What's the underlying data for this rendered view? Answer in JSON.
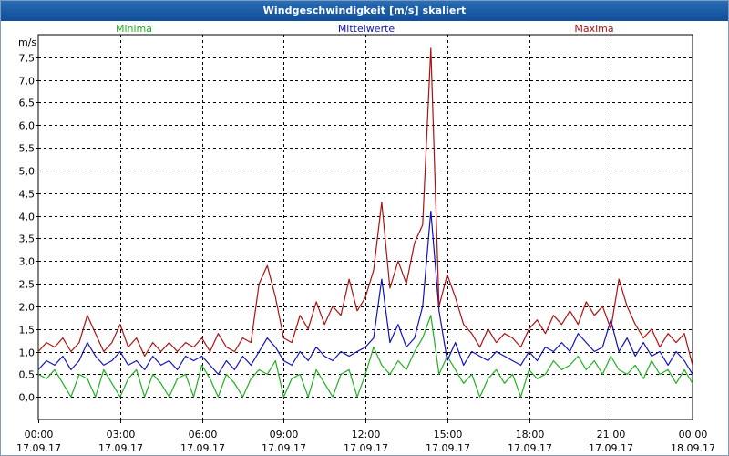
{
  "window": {
    "title": "Windgeschwindigkeit [m/s] skaliert"
  },
  "colors": {
    "min": "#20b020",
    "mean": "#1010c0",
    "max": "#b01010",
    "grid": "#000000"
  },
  "chart_data": {
    "type": "line",
    "title": "Windgeschwindigkeit [m/s] skaliert",
    "ylabel": "m/s",
    "ylim": [
      -0.5,
      8.0
    ],
    "xlim": [
      0,
      24
    ],
    "yticks": [
      0,
      0.5,
      1,
      1.5,
      2,
      2.5,
      3,
      3.5,
      4,
      4.5,
      5,
      5.5,
      6,
      6.5,
      7,
      7.5
    ],
    "ytick_labels": [
      "0,0",
      "0,5",
      "1,0",
      "1,5",
      "2,0",
      "2,5",
      "3,0",
      "3,5",
      "4,0",
      "4,5",
      "5,0",
      "5,5",
      "6,0",
      "6,5",
      "7,0",
      "7,5"
    ],
    "xticks": [
      {
        "x": 0,
        "time": "00:00",
        "date": "17.09.17"
      },
      {
        "x": 3,
        "time": "03:00",
        "date": "17.09.17"
      },
      {
        "x": 6,
        "time": "06:00",
        "date": "17.09.17"
      },
      {
        "x": 9,
        "time": "09:00",
        "date": "17.09.17"
      },
      {
        "x": 12,
        "time": "12:00",
        "date": "17.09.17"
      },
      {
        "x": 15,
        "time": "15:00",
        "date": "17.09.17"
      },
      {
        "x": 18,
        "time": "18:00",
        "date": "17.09.17"
      },
      {
        "x": 21,
        "time": "21:00",
        "date": "17.09.17"
      },
      {
        "x": 24,
        "time": "00:00",
        "date": "18.09.17"
      }
    ],
    "grid": true,
    "legend": "top",
    "series": [
      {
        "name": "Minima",
        "color": "#20b020",
        "x": [
          0,
          0.3,
          0.6,
          0.9,
          1.2,
          1.5,
          1.8,
          2.1,
          2.4,
          2.7,
          3.0,
          3.3,
          3.6,
          3.9,
          4.2,
          4.5,
          4.8,
          5.1,
          5.4,
          5.7,
          6.0,
          6.3,
          6.6,
          6.9,
          7.2,
          7.5,
          7.8,
          8.1,
          8.4,
          8.7,
          9.0,
          9.3,
          9.6,
          9.9,
          10.2,
          10.5,
          10.8,
          11.1,
          11.4,
          11.7,
          12.0,
          12.3,
          12.6,
          12.9,
          13.2,
          13.5,
          13.8,
          14.1,
          14.4,
          14.7,
          15.0,
          15.3,
          15.6,
          15.9,
          16.2,
          16.5,
          16.8,
          17.1,
          17.4,
          17.7,
          18.0,
          18.3,
          18.6,
          18.9,
          19.2,
          19.5,
          19.8,
          20.1,
          20.4,
          20.7,
          21.0,
          21.3,
          21.6,
          21.9,
          22.2,
          22.5,
          22.8,
          23.1,
          23.4,
          23.7,
          24.0
        ],
        "y": [
          0.5,
          0.4,
          0.6,
          0.3,
          0,
          0.5,
          0.4,
          0,
          0.6,
          0.3,
          0,
          0.4,
          0.6,
          0,
          0.5,
          0.3,
          0,
          0.4,
          0.5,
          0,
          0.7,
          0.4,
          0,
          0.5,
          0.3,
          0,
          0.4,
          0.6,
          0.5,
          0.8,
          0,
          0.4,
          0.5,
          0,
          0.6,
          0.3,
          0,
          0.5,
          0.6,
          0,
          0.5,
          1.1,
          0.7,
          0.5,
          0.8,
          0.6,
          1.0,
          1.3,
          1.8,
          0.5,
          0.9,
          0.6,
          0.3,
          0.5,
          0,
          0.4,
          0.6,
          0.3,
          0.5,
          0,
          0.6,
          0.4,
          0.5,
          0.8,
          0.6,
          0.7,
          0.9,
          0.6,
          0.8,
          0.5,
          0.9,
          0.6,
          0.5,
          0.7,
          0.4,
          0.8,
          0.5,
          0.6,
          0.3,
          0.6,
          0.3
        ]
      },
      {
        "name": "Mittelwerte",
        "color": "#1010c0",
        "x": [
          0,
          0.3,
          0.6,
          0.9,
          1.2,
          1.5,
          1.8,
          2.1,
          2.4,
          2.7,
          3.0,
          3.3,
          3.6,
          3.9,
          4.2,
          4.5,
          4.8,
          5.1,
          5.4,
          5.7,
          6.0,
          6.3,
          6.6,
          6.9,
          7.2,
          7.5,
          7.8,
          8.1,
          8.4,
          8.7,
          9.0,
          9.3,
          9.6,
          9.9,
          10.2,
          10.5,
          10.8,
          11.1,
          11.4,
          11.7,
          12.0,
          12.3,
          12.6,
          12.9,
          13.2,
          13.5,
          13.8,
          14.1,
          14.4,
          14.7,
          15.0,
          15.3,
          15.6,
          15.9,
          16.2,
          16.5,
          16.8,
          17.1,
          17.4,
          17.7,
          18.0,
          18.3,
          18.6,
          18.9,
          19.2,
          19.5,
          19.8,
          20.1,
          20.4,
          20.7,
          21.0,
          21.3,
          21.6,
          21.9,
          22.2,
          22.5,
          22.8,
          23.1,
          23.4,
          23.7,
          24.0
        ],
        "y": [
          0.6,
          0.8,
          0.7,
          0.9,
          0.6,
          0.8,
          1.2,
          0.9,
          0.7,
          0.8,
          1.0,
          0.7,
          0.8,
          0.6,
          0.9,
          0.7,
          0.8,
          0.6,
          0.9,
          0.8,
          0.9,
          0.7,
          0.5,
          0.8,
          0.6,
          0.9,
          0.7,
          1.0,
          1.3,
          1.1,
          0.8,
          0.7,
          1.0,
          0.8,
          1.1,
          0.9,
          0.8,
          1.0,
          0.9,
          1.0,
          1.1,
          1.3,
          2.6,
          1.2,
          1.6,
          1.1,
          1.3,
          2.0,
          4.1,
          1.9,
          0.8,
          1.2,
          0.7,
          1.0,
          0.9,
          0.8,
          1.0,
          0.9,
          0.8,
          0.7,
          1.0,
          0.8,
          1.1,
          1.0,
          1.2,
          1.0,
          1.4,
          1.2,
          1.0,
          1.1,
          1.7,
          1.0,
          1.3,
          0.9,
          1.2,
          0.9,
          1.0,
          0.7,
          1.0,
          0.8,
          0.5
        ]
      },
      {
        "name": "Maxima",
        "color": "#b01010",
        "x": [
          0,
          0.3,
          0.6,
          0.9,
          1.2,
          1.5,
          1.8,
          2.1,
          2.4,
          2.7,
          3.0,
          3.3,
          3.6,
          3.9,
          4.2,
          4.5,
          4.8,
          5.1,
          5.4,
          5.7,
          6.0,
          6.3,
          6.6,
          6.9,
          7.2,
          7.5,
          7.8,
          8.1,
          8.4,
          8.7,
          9.0,
          9.3,
          9.6,
          9.9,
          10.2,
          10.5,
          10.8,
          11.1,
          11.4,
          11.7,
          12.0,
          12.3,
          12.6,
          12.9,
          13.2,
          13.5,
          13.8,
          14.1,
          14.4,
          14.7,
          15.0,
          15.3,
          15.6,
          15.9,
          16.2,
          16.5,
          16.8,
          17.1,
          17.4,
          17.7,
          18.0,
          18.3,
          18.6,
          18.9,
          19.2,
          19.5,
          19.8,
          20.1,
          20.4,
          20.7,
          21.0,
          21.3,
          21.6,
          21.9,
          22.2,
          22.5,
          22.8,
          23.1,
          23.4,
          23.7,
          24.0
        ],
        "y": [
          1.0,
          1.2,
          1.1,
          1.3,
          1.0,
          1.2,
          1.8,
          1.4,
          1.0,
          1.2,
          1.6,
          1.1,
          1.3,
          0.9,
          1.2,
          1.0,
          1.2,
          1.0,
          1.2,
          1.1,
          1.3,
          1.0,
          1.4,
          1.1,
          1.0,
          1.3,
          1.2,
          2.5,
          2.9,
          2.2,
          1.3,
          1.2,
          1.8,
          1.5,
          2.1,
          1.6,
          2.0,
          1.8,
          2.6,
          1.9,
          2.2,
          2.8,
          4.3,
          2.4,
          3.0,
          2.5,
          3.4,
          3.8,
          7.7,
          2.0,
          2.7,
          2.2,
          1.6,
          1.4,
          1.1,
          1.5,
          1.2,
          1.4,
          1.3,
          1.1,
          1.5,
          1.7,
          1.4,
          1.8,
          1.6,
          1.9,
          1.6,
          2.1,
          1.8,
          2.0,
          1.5,
          2.6,
          2.0,
          1.6,
          1.3,
          1.5,
          1.1,
          1.4,
          1.2,
          1.4,
          0.7
        ]
      }
    ]
  }
}
